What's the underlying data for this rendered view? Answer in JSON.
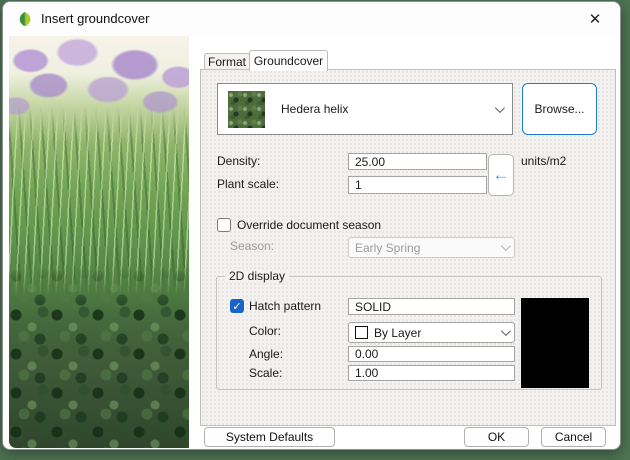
{
  "window": {
    "title": "Insert groundcover",
    "close_glyph": "✕"
  },
  "tabs": [
    {
      "label": "Format",
      "active": false
    },
    {
      "label": "Groundcover",
      "active": true
    }
  ],
  "plant_selector": {
    "value": "Hedera helix",
    "browse_label": "Browse...",
    "transfer_arrow_glyph": "←"
  },
  "fields": {
    "density": {
      "label": "Density:",
      "value": "25.00",
      "unit": "units/m2"
    },
    "plant_scale": {
      "label": "Plant scale:",
      "value": "1"
    }
  },
  "season": {
    "override_label": "Override document season",
    "override_checked": false,
    "label": "Season:",
    "value": "Early Spring",
    "enabled": false
  },
  "display_2d": {
    "group_label": "2D display",
    "hatch": {
      "label": "Hatch pattern",
      "checked": true,
      "check_glyph": "✓",
      "value": "SOLID"
    },
    "color": {
      "label": "Color:",
      "value": "By Layer",
      "swatch_color": "#ffffff"
    },
    "angle": {
      "label": "Angle:",
      "value": "0.00"
    },
    "scale": {
      "label": "Scale:",
      "value": "1.00"
    },
    "preview_color": "#000000"
  },
  "buttons": {
    "system_defaults": "System Defaults",
    "ok": "OK",
    "cancel": "Cancel"
  },
  "colors": {
    "background_green": "#4d7354",
    "focus_blue": "#1a7ad4",
    "checkbox_blue": "#1566c8",
    "arrow_blue": "#4f93d8"
  }
}
